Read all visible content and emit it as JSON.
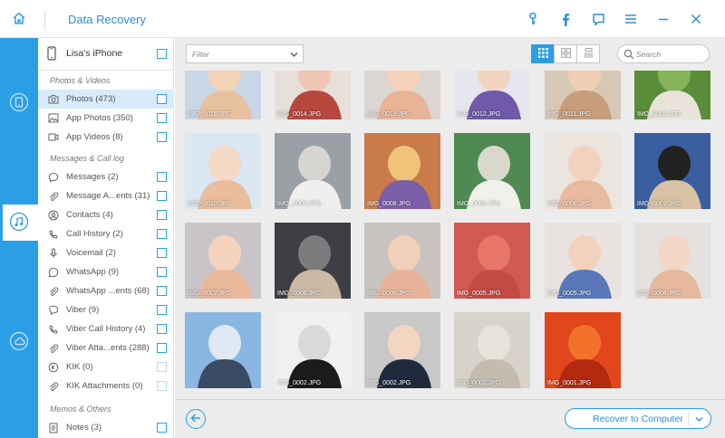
{
  "app": {
    "title": "Data Recovery",
    "colors": {
      "accent": "#2b9fe6",
      "title_text": "#2b8fd8",
      "selected_row": "#d7ebfb"
    }
  },
  "titlebar": {
    "icons": [
      "home-icon",
      "key-icon",
      "facebook-icon",
      "feedback-icon",
      "menu-icon",
      "minimize-icon",
      "close-icon"
    ]
  },
  "rail": {
    "items": [
      "phone-restore-icon",
      "itunes-music-icon",
      "icloud-icon"
    ],
    "active": "itunes-music-icon"
  },
  "sidebar": {
    "device": "Lisa's iPhone",
    "sections": [
      {
        "label": "Photos & Videos",
        "items": [
          {
            "label": "Photos (473)",
            "icon": "camera-icon",
            "selected": true
          },
          {
            "label": "App Photos (350)",
            "icon": "image-icon"
          },
          {
            "label": "App Videos (8)",
            "icon": "video-icon"
          }
        ]
      },
      {
        "label": "Messages & Call log",
        "items": [
          {
            "label": "Messages (2)",
            "icon": "message-icon"
          },
          {
            "label": "Message A...ents (31)",
            "icon": "attachment-icon"
          },
          {
            "label": "Contacts (4)",
            "icon": "contacts-icon"
          },
          {
            "label": "Call History (2)",
            "icon": "call-icon"
          },
          {
            "label": "Voicemail (2)",
            "icon": "microphone-icon"
          },
          {
            "label": "WhatsApp (9)",
            "icon": "whatsapp-icon"
          },
          {
            "label": "WhatsApp ...ents (68)",
            "icon": "attachment-icon"
          },
          {
            "label": "Viber (9)",
            "icon": "viber-icon"
          },
          {
            "label": "Viber Call History (4)",
            "icon": "call-icon"
          },
          {
            "label": "Viber Atta...ents (288)",
            "icon": "attachment-icon"
          },
          {
            "label": "KIK (0)",
            "icon": "kik-icon",
            "disabled": true
          },
          {
            "label": "KIK Attachments (0)",
            "icon": "attachment-icon",
            "disabled": true
          }
        ]
      },
      {
        "label": "Memos & Others",
        "items": [
          {
            "label": "Notes (3)",
            "icon": "notes-icon"
          }
        ]
      }
    ]
  },
  "toolbar": {
    "filter_placeholder": "Filter",
    "views": [
      "grid-view-icon",
      "large-grid-icon",
      "list-view-icon"
    ],
    "active_view": "grid-view-icon",
    "search_placeholder": "Search"
  },
  "gallery": {
    "photos": [
      {
        "caption": "IMG_0015.JPG"
      },
      {
        "caption": "IMG_0014.JPG"
      },
      {
        "caption": "IMG_0013.JPG"
      },
      {
        "caption": "IMG_0012.JPG"
      },
      {
        "caption": "IMG_0011.JPG"
      },
      {
        "caption": "IMG_0010.JPG"
      },
      {
        "caption": "IMG_0010.JPG"
      },
      {
        "caption": "IMG_0009.JPG"
      },
      {
        "caption": "IMG_0008.JPG"
      },
      {
        "caption": "IMG_0008.JPG"
      },
      {
        "caption": "IMG_0008.JPG"
      },
      {
        "caption": "IMG_0007.JPG"
      },
      {
        "caption": "IMG_0007.JPG"
      },
      {
        "caption": "IMG_0006.JPG"
      },
      {
        "caption": "IMG_0006.JPG"
      },
      {
        "caption": "IMG_0005.JPG"
      },
      {
        "caption": "IMG_0005.JPG"
      },
      {
        "caption": "IMG_0004.JPG"
      },
      {
        "caption": ""
      },
      {
        "caption": "IMG_0002.JPG"
      },
      {
        "caption": "IMG_0002.JPG"
      },
      {
        "caption": "IMG_0001.JPG"
      },
      {
        "caption": "IMG_0001.JPG"
      }
    ]
  },
  "footer": {
    "recover_label": "Recover to Computer"
  }
}
